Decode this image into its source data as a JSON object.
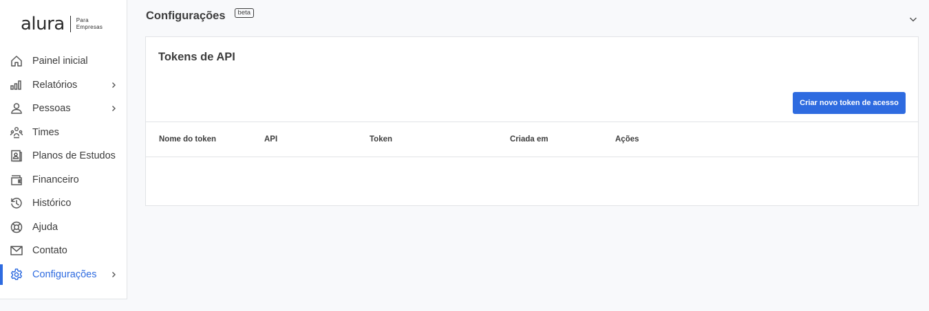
{
  "logo": {
    "word": "alura",
    "sub_line1": "Para",
    "sub_line2": "Empresas"
  },
  "sidebar": {
    "items": [
      {
        "label": "Painel inicial",
        "icon": "home-icon",
        "chevron": false,
        "active": false
      },
      {
        "label": "Relatórios",
        "icon": "bar-chart-icon",
        "chevron": true,
        "active": false
      },
      {
        "label": "Pessoas",
        "icon": "person-icon",
        "chevron": true,
        "active": false
      },
      {
        "label": "Times",
        "icon": "team-icon",
        "chevron": false,
        "active": false
      },
      {
        "label": "Planos de Estudos",
        "icon": "study-plan-icon",
        "chevron": false,
        "active": false
      },
      {
        "label": "Financeiro",
        "icon": "wallet-icon",
        "chevron": false,
        "active": false
      },
      {
        "label": "Histórico",
        "icon": "history-icon",
        "chevron": false,
        "active": false
      },
      {
        "label": "Ajuda",
        "icon": "lifebuoy-icon",
        "chevron": false,
        "active": false
      },
      {
        "label": "Contato",
        "icon": "mail-icon",
        "chevron": false,
        "active": false
      },
      {
        "label": "Configurações",
        "icon": "gear-icon",
        "chevron": true,
        "active": true
      }
    ]
  },
  "header": {
    "title": "Configurações",
    "badge": "beta"
  },
  "card": {
    "title": "Tokens de API",
    "create_button": "Criar novo token de acesso",
    "columns": [
      "Nome do token",
      "API",
      "Token",
      "Criada em",
      "Ações"
    ],
    "rows": []
  },
  "colors": {
    "accent": "#2e6be0",
    "text": "#3c3c3c",
    "background": "#f8f9fb",
    "border": "#e1e3e6"
  }
}
